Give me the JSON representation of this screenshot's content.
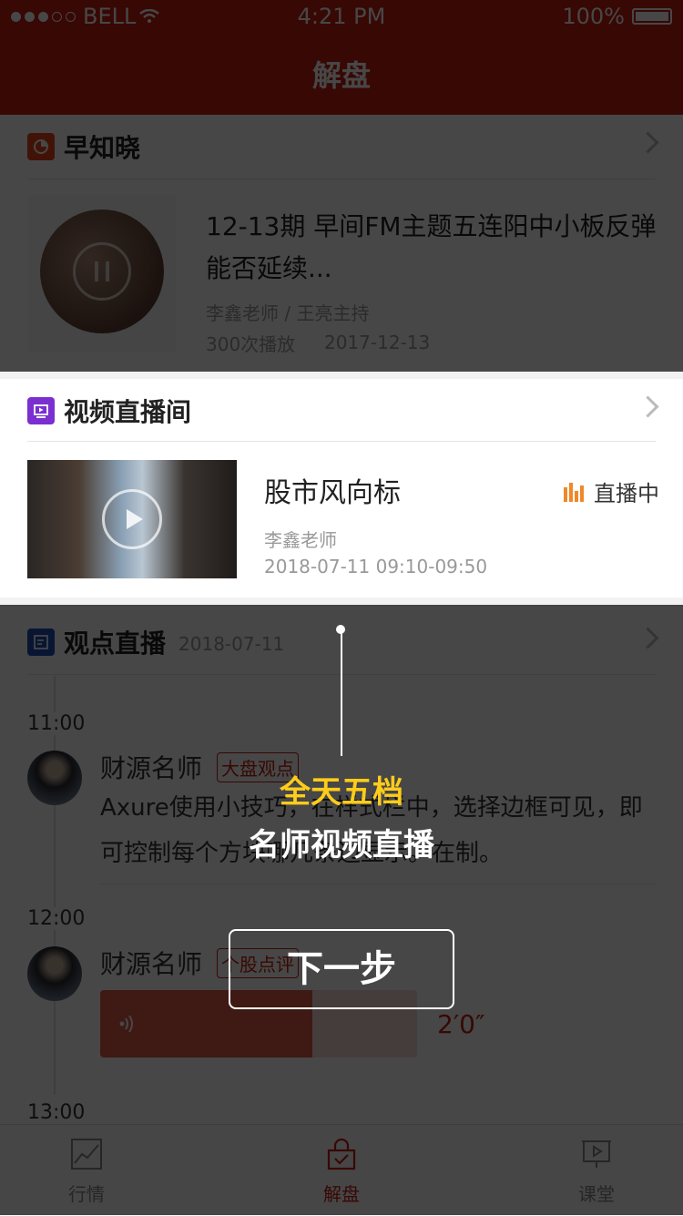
{
  "status_bar": {
    "carrier": "BELL",
    "time": "4:21 PM",
    "battery": "100%"
  },
  "nav": {
    "title": "解盘"
  },
  "early_news": {
    "title": "早知晓",
    "item": {
      "title": "12-13期 早间FM主题五连阳中小板反弹能否延续...",
      "authors": "李鑫老师 / 王亮主持",
      "plays": "300次播放",
      "date": "2017-12-13"
    }
  },
  "live_room": {
    "title": "视频直播间",
    "item": {
      "title": "股市风向标",
      "status": "直播中",
      "teacher": "李鑫老师",
      "time": "2018-07-11 09:10-09:50"
    }
  },
  "viewpoints": {
    "title": "观点直播",
    "date": "2018-07-11",
    "posts": [
      {
        "time": "11:00",
        "author": "财源名师",
        "tag": "大盘观点",
        "text": "Axure使用小技巧，在样式栏中，选择边框可见，即可控制每个方块哪几条边显示。在制。"
      },
      {
        "time": "12:00",
        "author": "财源名师",
        "tag": "个股点评",
        "duration": "2′0″",
        "played_fraction": 0.67
      },
      {
        "time": "13:00"
      }
    ]
  },
  "guide": {
    "line1": "全天五档",
    "line2": "名师视频直播",
    "next_button": "下一步"
  },
  "tabbar": {
    "tabs": [
      {
        "label": "行情",
        "icon": "chart-icon"
      },
      {
        "label": "解盘",
        "icon": "lock-check-icon",
        "active": true
      },
      {
        "label": "课堂",
        "icon": "screen-play-icon"
      }
    ]
  },
  "colors": {
    "brand_red": "#c81d0f",
    "guide_yellow": "#ffcc1a",
    "live_orange": "#f0882a"
  }
}
